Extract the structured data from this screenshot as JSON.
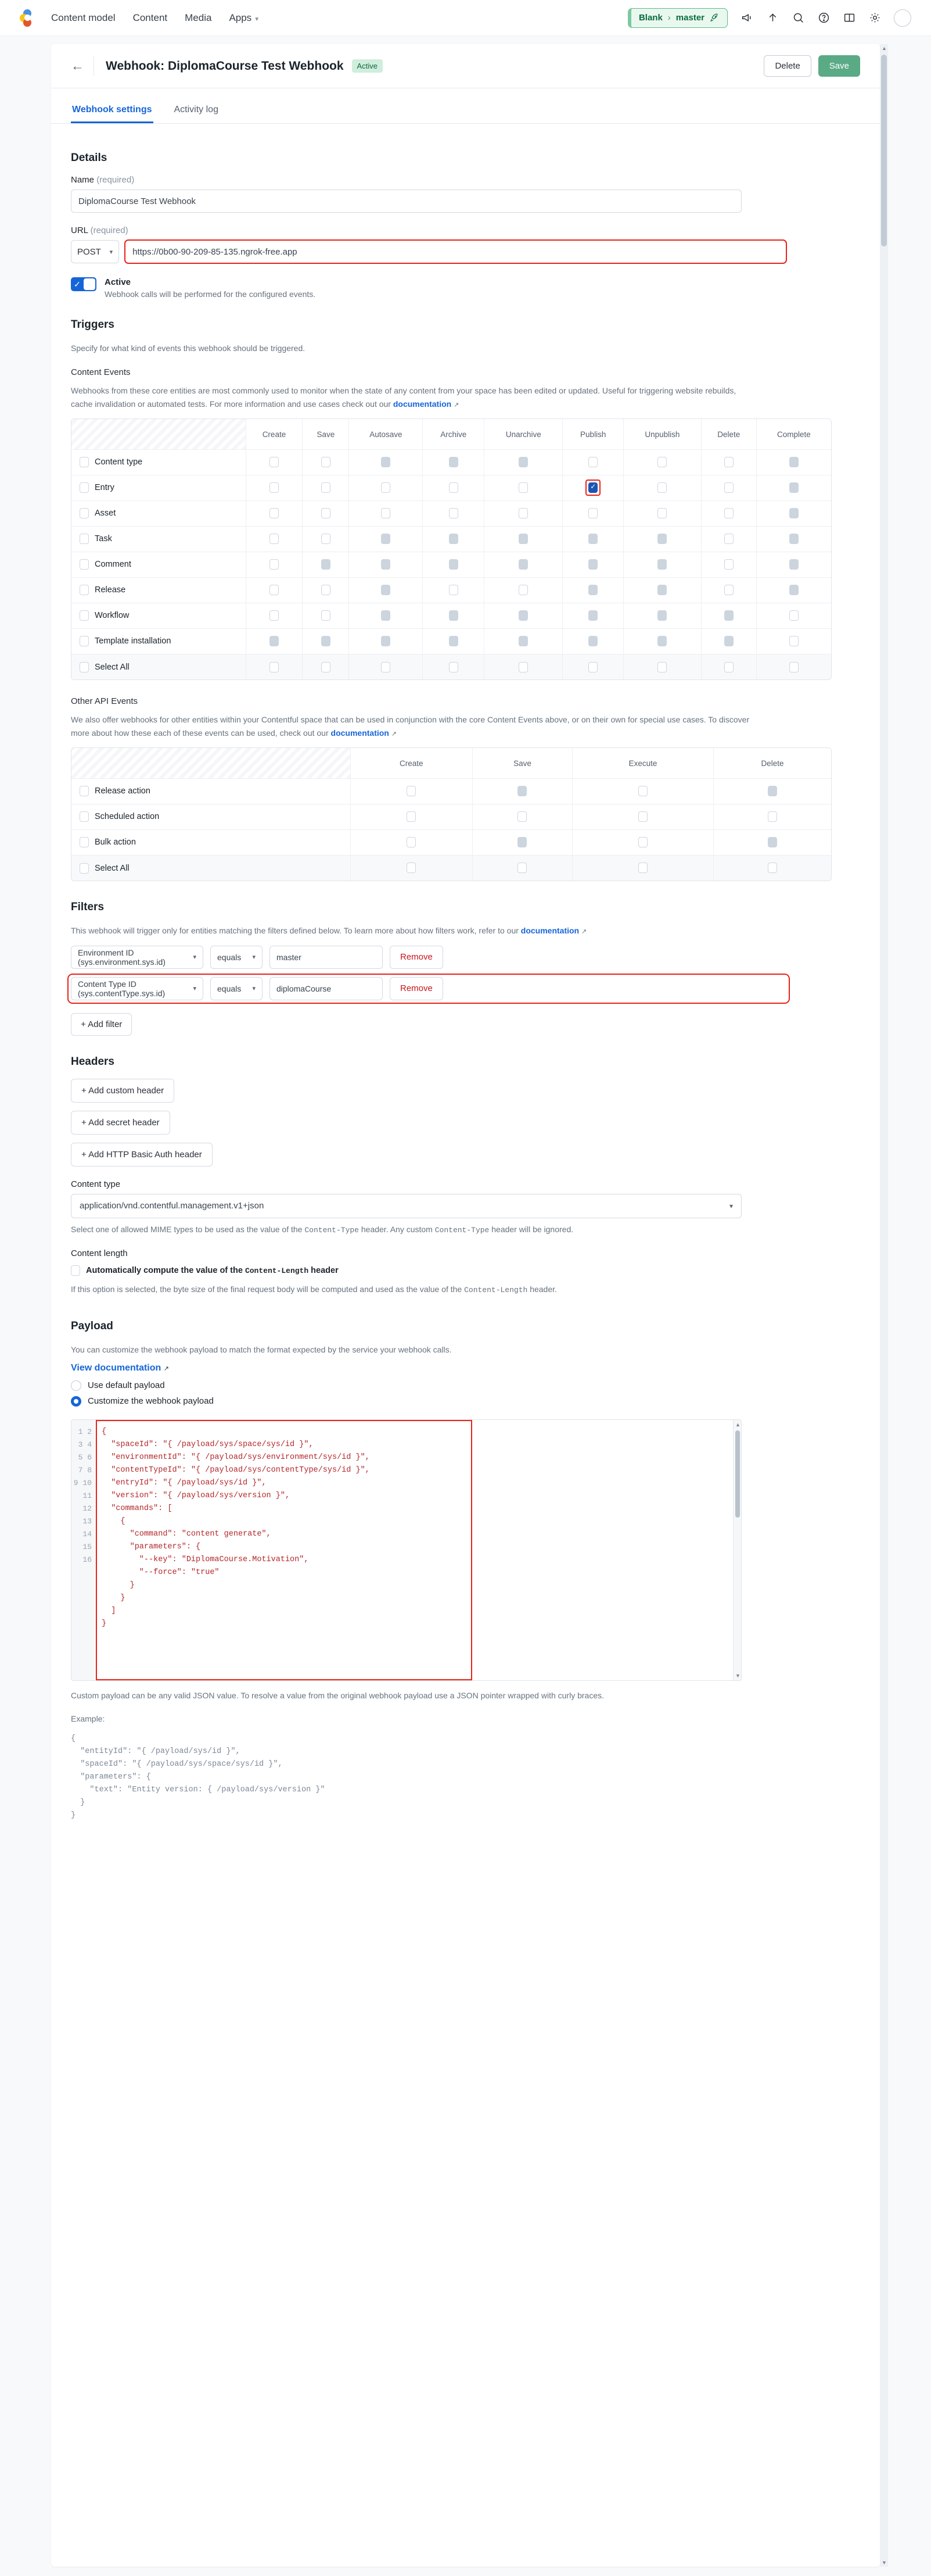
{
  "topnav": {
    "links": [
      "Content model",
      "Content",
      "Media",
      "Apps"
    ],
    "env_space": "Blank",
    "env_sep": "›",
    "env_branch": "master",
    "icons": [
      "megaphone-icon",
      "arrow-up-icon",
      "search-icon",
      "help-circle-icon",
      "book-icon",
      "gear-icon",
      "avatar"
    ]
  },
  "header": {
    "title": "Webhook: DiplomaCourse Test Webhook",
    "status_badge": "Active",
    "delete_label": "Delete",
    "save_label": "Save"
  },
  "tabs": [
    {
      "label": "Webhook settings",
      "active": true
    },
    {
      "label": "Activity log",
      "active": false
    }
  ],
  "details": {
    "heading": "Details",
    "name_label": "Name",
    "name_required": "(required)",
    "name_value": "DiplomaCourse Test Webhook",
    "url_label": "URL",
    "url_required": "(required)",
    "method": "POST",
    "url_value": "https://0b00-90-209-85-135.ngrok-free.app",
    "active_label": "Active",
    "active_help": "Webhook calls will be performed for the configured events.",
    "active_on": true
  },
  "triggers": {
    "heading": "Triggers",
    "intro": "Specify for what kind of events this webhook should be triggered.",
    "content_events_heading": "Content Events",
    "content_events_desc_pre": "Webhooks from these core entities are most commonly used to monitor when the state of any content from your space has been edited or updated. Useful for triggering website rebuilds, cache invalidation or automated tests. For more information and use cases check out our ",
    "content_events_link": "documentation",
    "content_columns": [
      "Create",
      "Save",
      "Autosave",
      "Archive",
      "Unarchive",
      "Publish",
      "Unpublish",
      "Delete",
      "Complete"
    ],
    "content_rows": [
      {
        "label": "Content type",
        "states": [
          "off",
          "off",
          "disabled",
          "disabled",
          "disabled",
          "off",
          "off",
          "off",
          "disabled"
        ]
      },
      {
        "label": "Entry",
        "states": [
          "off",
          "off",
          "off",
          "off",
          "off",
          "checked",
          "off",
          "off",
          "disabled"
        ]
      },
      {
        "label": "Asset",
        "states": [
          "off",
          "off",
          "off",
          "off",
          "off",
          "off",
          "off",
          "off",
          "disabled"
        ]
      },
      {
        "label": "Task",
        "states": [
          "off",
          "off",
          "disabled",
          "disabled",
          "disabled",
          "disabled",
          "disabled",
          "off",
          "disabled"
        ]
      },
      {
        "label": "Comment",
        "states": [
          "off",
          "disabled",
          "disabled",
          "disabled",
          "disabled",
          "disabled",
          "disabled",
          "off",
          "disabled"
        ]
      },
      {
        "label": "Release",
        "states": [
          "off",
          "off",
          "disabled",
          "off",
          "off",
          "disabled",
          "disabled",
          "off",
          "disabled"
        ]
      },
      {
        "label": "Workflow",
        "states": [
          "off",
          "off",
          "disabled",
          "disabled",
          "disabled",
          "disabled",
          "disabled",
          "disabled",
          "off"
        ]
      },
      {
        "label": "Template installation",
        "states": [
          "disabled",
          "disabled",
          "disabled",
          "disabled",
          "disabled",
          "disabled",
          "disabled",
          "disabled",
          "off"
        ]
      },
      {
        "label": "Select All",
        "states": [
          "off",
          "off",
          "off",
          "off",
          "off",
          "off",
          "off",
          "off",
          "off"
        ]
      }
    ],
    "other_events_heading": "Other API Events",
    "other_events_desc_pre": "We also offer webhooks for other entities within your Contentful space that can be used in conjunction with the core Content Events above, or on their own for special use cases. To discover more about how these each of these events can be used, check out our ",
    "other_events_link": "documentation",
    "other_columns": [
      "Create",
      "Save",
      "Execute",
      "Delete"
    ],
    "other_rows": [
      {
        "label": "Release action",
        "states": [
          "off",
          "disabled",
          "off",
          "disabled"
        ]
      },
      {
        "label": "Scheduled action",
        "states": [
          "off",
          "off",
          "off",
          "off"
        ]
      },
      {
        "label": "Bulk action",
        "states": [
          "off",
          "disabled",
          "off",
          "disabled"
        ]
      },
      {
        "label": "Select All",
        "states": [
          "off",
          "off",
          "off",
          "off"
        ]
      }
    ]
  },
  "filters": {
    "heading": "Filters",
    "desc_pre": "This webhook will trigger only for entities matching the filters defined below. To learn more about how filters work, refer to our ",
    "link": "documentation",
    "operator_label": "equals",
    "remove_label": "Remove",
    "add_label": "+ Add filter",
    "rows": [
      {
        "field": "Environment ID (sys.environment.sys.id)",
        "operator": "equals",
        "value": "master",
        "highlight": false
      },
      {
        "field": "Content Type ID (sys.contentType.sys.id)",
        "operator": "equals",
        "value": "diplomaCourse",
        "highlight": true
      }
    ]
  },
  "headers": {
    "heading": "Headers",
    "buttons": [
      "+ Add custom header",
      "+ Add secret header",
      "+ Add HTTP Basic Auth header"
    ],
    "content_type_label": "Content type",
    "content_type_value": "application/vnd.contentful.management.v1+json",
    "content_type_help_a": "Select one of allowed MIME types to be used as the value of the ",
    "content_type_help_code1": "Content-Type",
    "content_type_help_b": " header. Any custom ",
    "content_type_help_code2": "Content-Type",
    "content_type_help_c": " header will be ignored.",
    "content_length_label": "Content length",
    "content_length_checkbox_a": "Automatically compute the value of the ",
    "content_length_checkbox_code": "Content-Length",
    "content_length_checkbox_b": " header",
    "content_length_help_a": "If this option is selected, the byte size of the final request body will be computed and used as the value of the ",
    "content_length_help_code": "Content-Length",
    "content_length_help_b": " header."
  },
  "payload": {
    "heading": "Payload",
    "desc": "You can customize the webhook payload to match the format expected by the service your webhook calls.",
    "view_doc": "View documentation",
    "option_default": "Use default payload",
    "option_custom": "Customize the webhook payload",
    "selected": "custom",
    "code_lines": [
      "{",
      "  \"spaceId\": \"{ /payload/sys/space/sys/id }\",",
      "  \"environmentId\": \"{ /payload/sys/environment/sys/id }\",",
      "  \"contentTypeId\": \"{ /payload/sys/contentType/sys/id }\",",
      "  \"entryId\": \"{ /payload/sys/id }\",",
      "  \"version\": \"{ /payload/sys/version }\",",
      "  \"commands\": [",
      "    {",
      "      \"command\": \"content generate\",",
      "      \"parameters\": {",
      "        \"--key\": \"DiplomaCourse.Motivation\",",
      "        \"--force\": \"true\"",
      "      }",
      "    }",
      "  ]",
      "}"
    ],
    "footer_note": "Custom payload can be any valid JSON value. To resolve a value from the original webhook payload use a JSON pointer wrapped with curly braces.",
    "example_label": "Example:",
    "example_code": "{\n  \"entityId\": \"{ /payload/sys/id }\",\n  \"spaceId\": \"{ /payload/sys/space/sys/id }\",\n  \"parameters\": {\n    \"text\": \"Entity version: { /payload/sys/version }\"\n  }\n}"
  },
  "colors": {
    "accent_blue": "#1665d8",
    "save_green": "#5aab85",
    "highlight_red": "#e8221a",
    "code_red": "#b3262a"
  }
}
